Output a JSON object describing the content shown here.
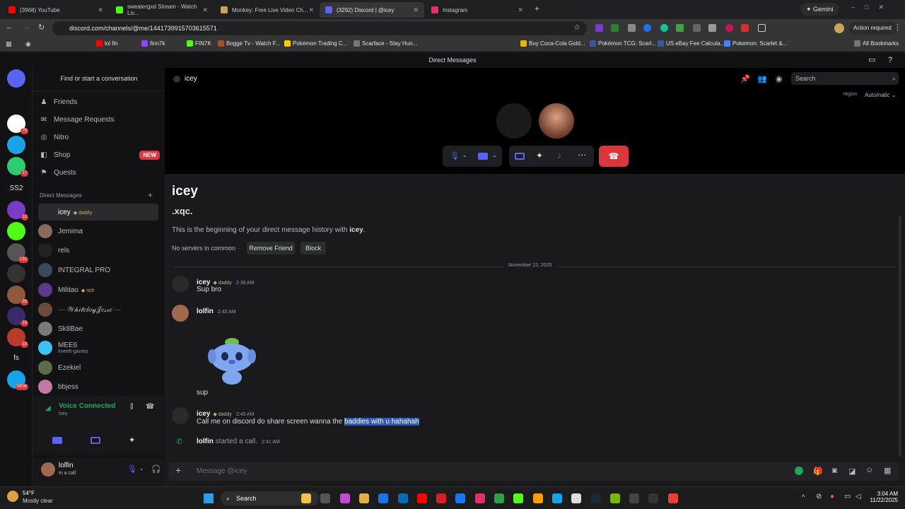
{
  "browser": {
    "tabs": [
      {
        "title": "(3968) YouTube",
        "color": "#ff0000"
      },
      {
        "title": "sweatergxd Stream - Watch Liv...",
        "color": "#53fc18"
      },
      {
        "title": "Monkey: Free Live Video Ch...",
        "color": "#c9a45c"
      },
      {
        "title": "(3292) Discord | @icey",
        "color": "#5865f2"
      },
      {
        "title": "Instagram",
        "color": "#e1306c"
      }
    ],
    "gemini_label": "Gemini",
    "url": "discord.com/channels/@me/1441739915703615571",
    "action_required": "Action required",
    "bookmarks": [
      "lol fin",
      "finn7k",
      "FIN7K",
      "Bogge Tv - Watch F...",
      "Pokémon Trading C...",
      "Scarface - Stay Hun...",
      "Buy Coca-Cola Gold...",
      "Pokémon TCG: Scarl...",
      "US eBay Fee Calcula...",
      "Pokemon: Scarlet &..."
    ],
    "all_bookmarks": "All Bookmarks"
  },
  "discord": {
    "window_title": "Direct Messages",
    "servers": [
      {
        "label": "",
        "color": "#5865f2",
        "badge": ""
      },
      {
        "label": "",
        "color": "#ffffff",
        "badge": "76"
      },
      {
        "label": "",
        "color": "#1aa3e8",
        "badge": ""
      },
      {
        "label": "",
        "color": "#2ecc71",
        "badge": "17"
      },
      {
        "label": "SS2",
        "color": "#121214",
        "badge": ""
      },
      {
        "label": "",
        "color": "#7a3cc4",
        "badge": "11"
      },
      {
        "label": "",
        "color": "#53fc18",
        "badge": ""
      },
      {
        "label": "",
        "color": "#555",
        "badge": "131"
      },
      {
        "label": "",
        "color": "#333",
        "badge": ""
      },
      {
        "label": "",
        "color": "#8a5a3a",
        "badge": "26"
      },
      {
        "label": "",
        "color": "#3a2a6a",
        "badge": "19"
      },
      {
        "label": "",
        "color": "#b83a2a",
        "badge": "18"
      },
      {
        "label": "fs",
        "color": "#121214",
        "badge": ""
      },
      {
        "label": "",
        "color": "#1aa3e8",
        "badge": "NEW"
      }
    ],
    "sidebar": {
      "search_placeholder": "Find or start a conversation",
      "nav": [
        {
          "label": "Friends",
          "icon": "friends-icon"
        },
        {
          "label": "Message Requests",
          "icon": "mail-icon"
        },
        {
          "label": "Nitro",
          "icon": "nitro-icon"
        },
        {
          "label": "Shop",
          "icon": "shop-icon",
          "badge": "NEW"
        },
        {
          "label": "Quests",
          "icon": "quests-icon"
        }
      ],
      "dm_header": "Direct Messages",
      "dms": [
        {
          "name": "icey",
          "tag": "daddy",
          "color": "#2a2a2a",
          "selected": true
        },
        {
          "name": "Jemima",
          "tag": "",
          "color": "#8a6a5a"
        },
        {
          "name": "rels",
          "tag": "",
          "color": "#222"
        },
        {
          "name": "INTEGRAL PRO",
          "tag": "",
          "color": "#3a4a5a"
        },
        {
          "name": "Militao",
          "tag": "rich",
          "color": "#5a3a8a"
        },
        {
          "name": "··· 𝒲𝒽𝒾𝓉𝑒𝒷𝑜𝓎𝒥𝑒𝓈𝓈𝑒 ···",
          "tag": "",
          "color": "#6a4a3a"
        },
        {
          "name": "Sk8Bae",
          "tag": "",
          "color": "#7a7a7a"
        },
        {
          "name": "MEE6",
          "tag": "",
          "sub": "/mee6-games",
          "color": "#3ec1f3"
        },
        {
          "name": "Ezekiel",
          "tag": "",
          "color": "#5a6a4a"
        },
        {
          "name": "bbjess",
          "tag": "",
          "color": "#c47aa0"
        }
      ],
      "voice": {
        "status": "Voice Connected",
        "channel": "icey"
      },
      "user": {
        "name": "lolfin",
        "status": "In a call"
      }
    },
    "call": {
      "title": "icey",
      "search_placeholder": "Search",
      "region_label": "region",
      "region_value": "Automatic"
    },
    "chat": {
      "profile_name": "icey",
      "profile_handle": ".xqc.",
      "intro_prefix": "This is the beginning of your direct message history with ",
      "intro_name": "icey",
      "intro_suffix": ".",
      "no_servers": "No servers in common",
      "remove_friend": "Remove Friend",
      "block": "Block",
      "date_divider": "November 22, 2025",
      "m1_author": "icey",
      "m1_tag": "daddy",
      "m1_time": "2:39 AM",
      "m1_text": "Sup bro",
      "m2_author": "lolfin",
      "m2_time": "2:40 AM",
      "m2_text": "sup",
      "m3_author": "icey",
      "m3_tag": "daddy",
      "m3_time": "2:40 AM",
      "m3_text_plain": "Call me on discord do share screen wanna the ",
      "m3_text_selected": "baddies with u  hahahah",
      "call_author": "lolfin",
      "call_text": " started a call.",
      "call_time": "2:41 AM",
      "composer_placeholder": "Message @icey"
    }
  },
  "taskbar": {
    "weather_temp": "54°F",
    "weather_desc": "Mostly clear",
    "search": "Search",
    "time": "3:04 AM",
    "date": "11/22/2025"
  }
}
